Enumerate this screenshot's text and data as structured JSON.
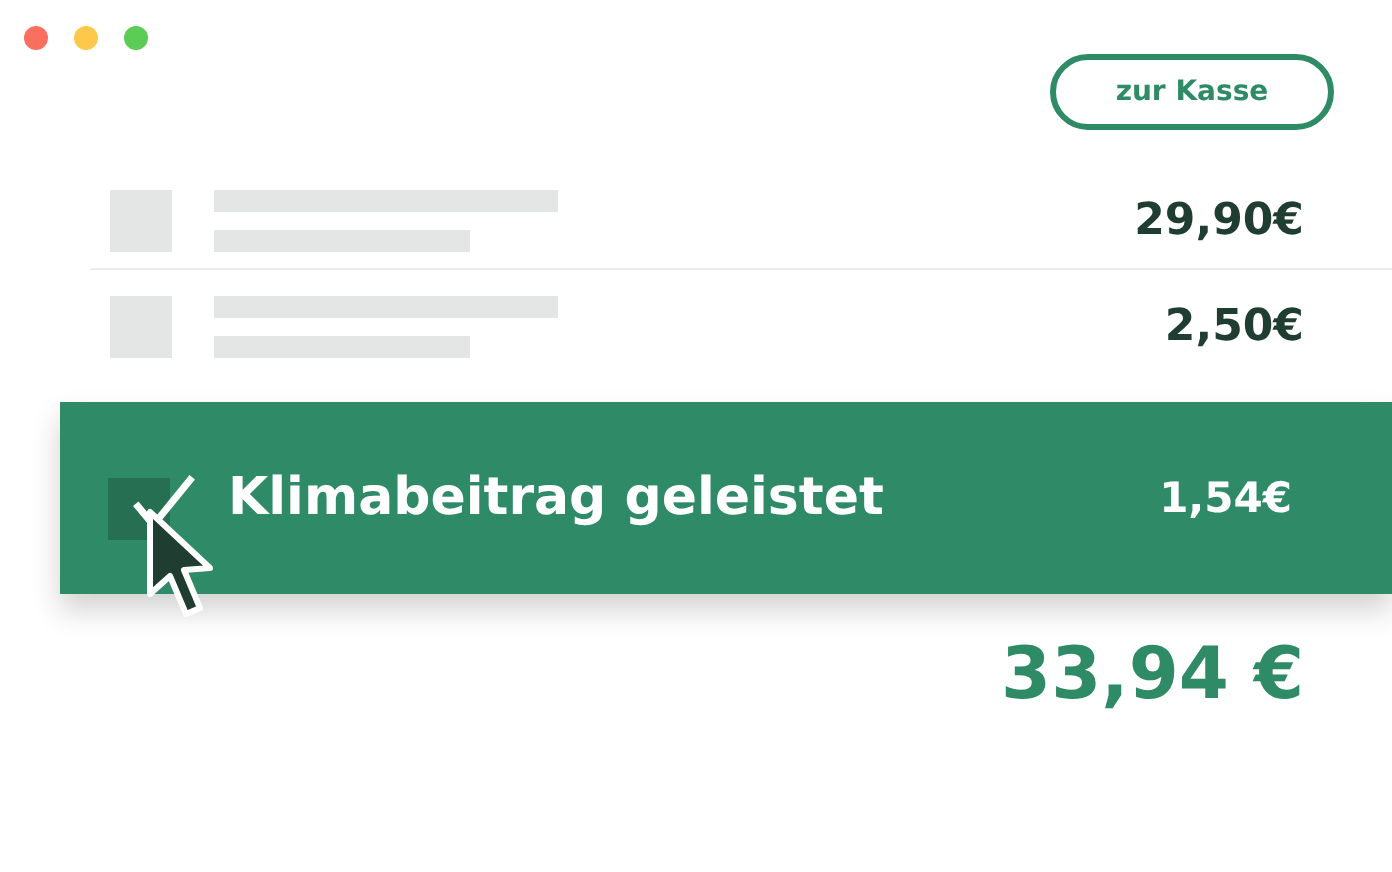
{
  "header": {
    "checkout_button": "zur Kasse"
  },
  "items": [
    {
      "price": "29,90€"
    },
    {
      "price": "2,50€"
    }
  ],
  "climate_option": {
    "label": "Klimabeitrag geleistet",
    "price": "1,54€",
    "checked": true
  },
  "total": "33,94 €"
}
